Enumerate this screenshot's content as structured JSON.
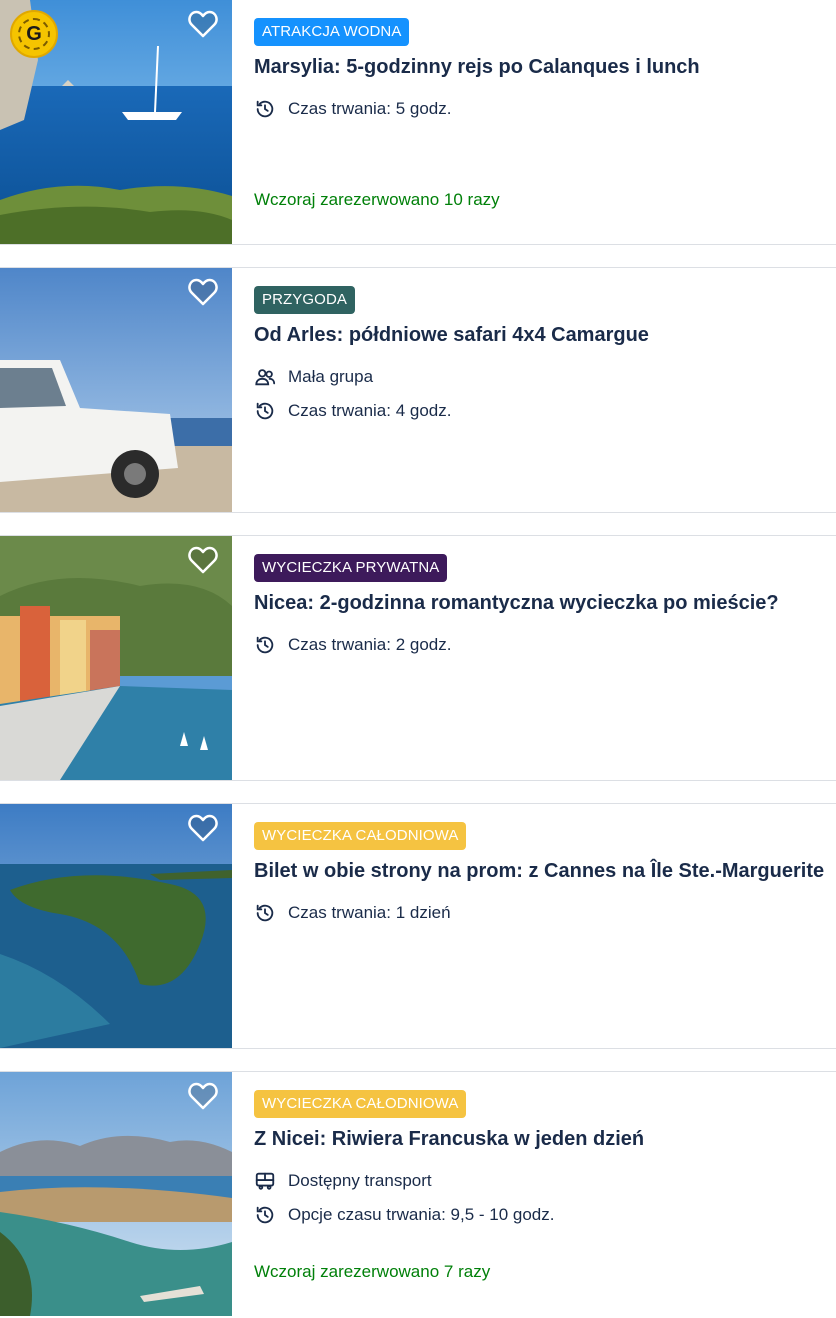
{
  "cards": [
    {
      "tag": "ATRAKCJA WODNA",
      "tag_color": "#1592fe",
      "title": "Marsylia: 5-godzinny rejs po Calanques i lunch",
      "duration": "Czas trwania: 5 godz.",
      "booked": "Wczoraj zarezerwowano 10 razy",
      "badge_letter": "G"
    },
    {
      "tag": "PRZYGODA",
      "tag_color": "#2f6361",
      "title": "Od Arles: półdniowe safari 4x4 Camargue",
      "group": "Mała grupa",
      "duration": "Czas trwania: 4 godz."
    },
    {
      "tag": "WYCIECZKA PRYWATNA",
      "tag_color": "#3d1a5b",
      "title": "Nicea: 2-godzinna romantyczna wycieczka po mieście?",
      "duration": "Czas trwania: 2 godz."
    },
    {
      "tag": "WYCIECZKA CAŁODNIOWA",
      "tag_color": "#f5c341",
      "title": "Bilet w obie strony na prom: z Cannes na Île Ste.-Marguerite",
      "duration": "Czas trwania: 1 dzień"
    },
    {
      "tag": "WYCIECZKA CAŁODNIOWA",
      "tag_color": "#f5c341",
      "title": "Z Nicei: Riwiera Francuska w jeden dzień",
      "transport": "Dostępny transport",
      "duration": "Opcje czasu trwania: 9,5 - 10 godz.",
      "booked": "Wczoraj zarezerwowano 7 razy"
    }
  ],
  "icons": {
    "heart": "heart-outline-icon",
    "duration": "clock-history-icon",
    "group": "small-group-icon",
    "transport": "bus-icon"
  }
}
